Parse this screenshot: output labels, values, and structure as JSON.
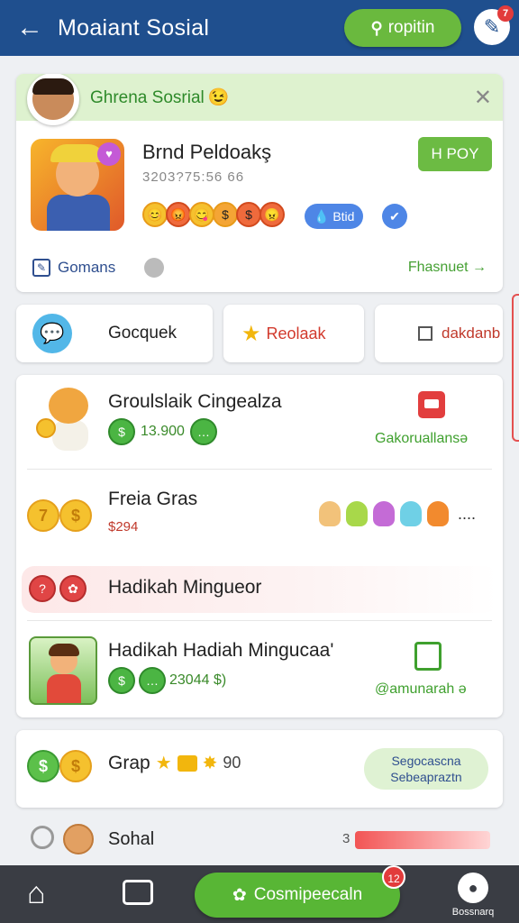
{
  "header": {
    "title": "Moaiant Sosial",
    "search_button_label": "ropitin",
    "edit_badge": "7"
  },
  "profile": {
    "name": "Ghrena Sosrial",
    "name_emoji": "😉",
    "game_title": "Brnd Peldoakş",
    "game_subtitle": "3203?75:56 66",
    "emojis": [
      "😊",
      "😡",
      "😋",
      "$",
      "$",
      "😠"
    ],
    "pill_label": "💧 Btid",
    "play_button": "H POY",
    "footer_left": "Gomans",
    "footer_right": "Fhasnuet →"
  },
  "tabs": [
    {
      "label": "Gocquek"
    },
    {
      "label": "Reolaak"
    },
    {
      "label": "dakdanb"
    }
  ],
  "list": {
    "row1_title": "Groulslaik Cingealza",
    "row1_value": "13.900",
    "row1_link": "Gakoruallansə",
    "row2_title": "Freia Gras",
    "row2_value": "$294",
    "row2_more": "....",
    "band_title": "Hadikah Mingueor",
    "row3_title": "Hadikah Hadiah Mingucaa'",
    "row3_value": "23044 $)",
    "row3_link": "@amunarah ə"
  },
  "grap": {
    "label": "Grap",
    "value": "90",
    "pill_line1": "Segocascna",
    "pill_line2": "Sebeapraztn"
  },
  "sohal": {
    "label": "Sohal",
    "value": "3"
  },
  "bottom_nav": {
    "cta_label": "Cosmipeecaln",
    "cta_badge": "12",
    "profile_label": "Bossnarq"
  },
  "colors": {
    "header_bg": "#1f4f8e",
    "accent_green": "#6ab93e",
    "nav_bg": "#3a3d44"
  }
}
